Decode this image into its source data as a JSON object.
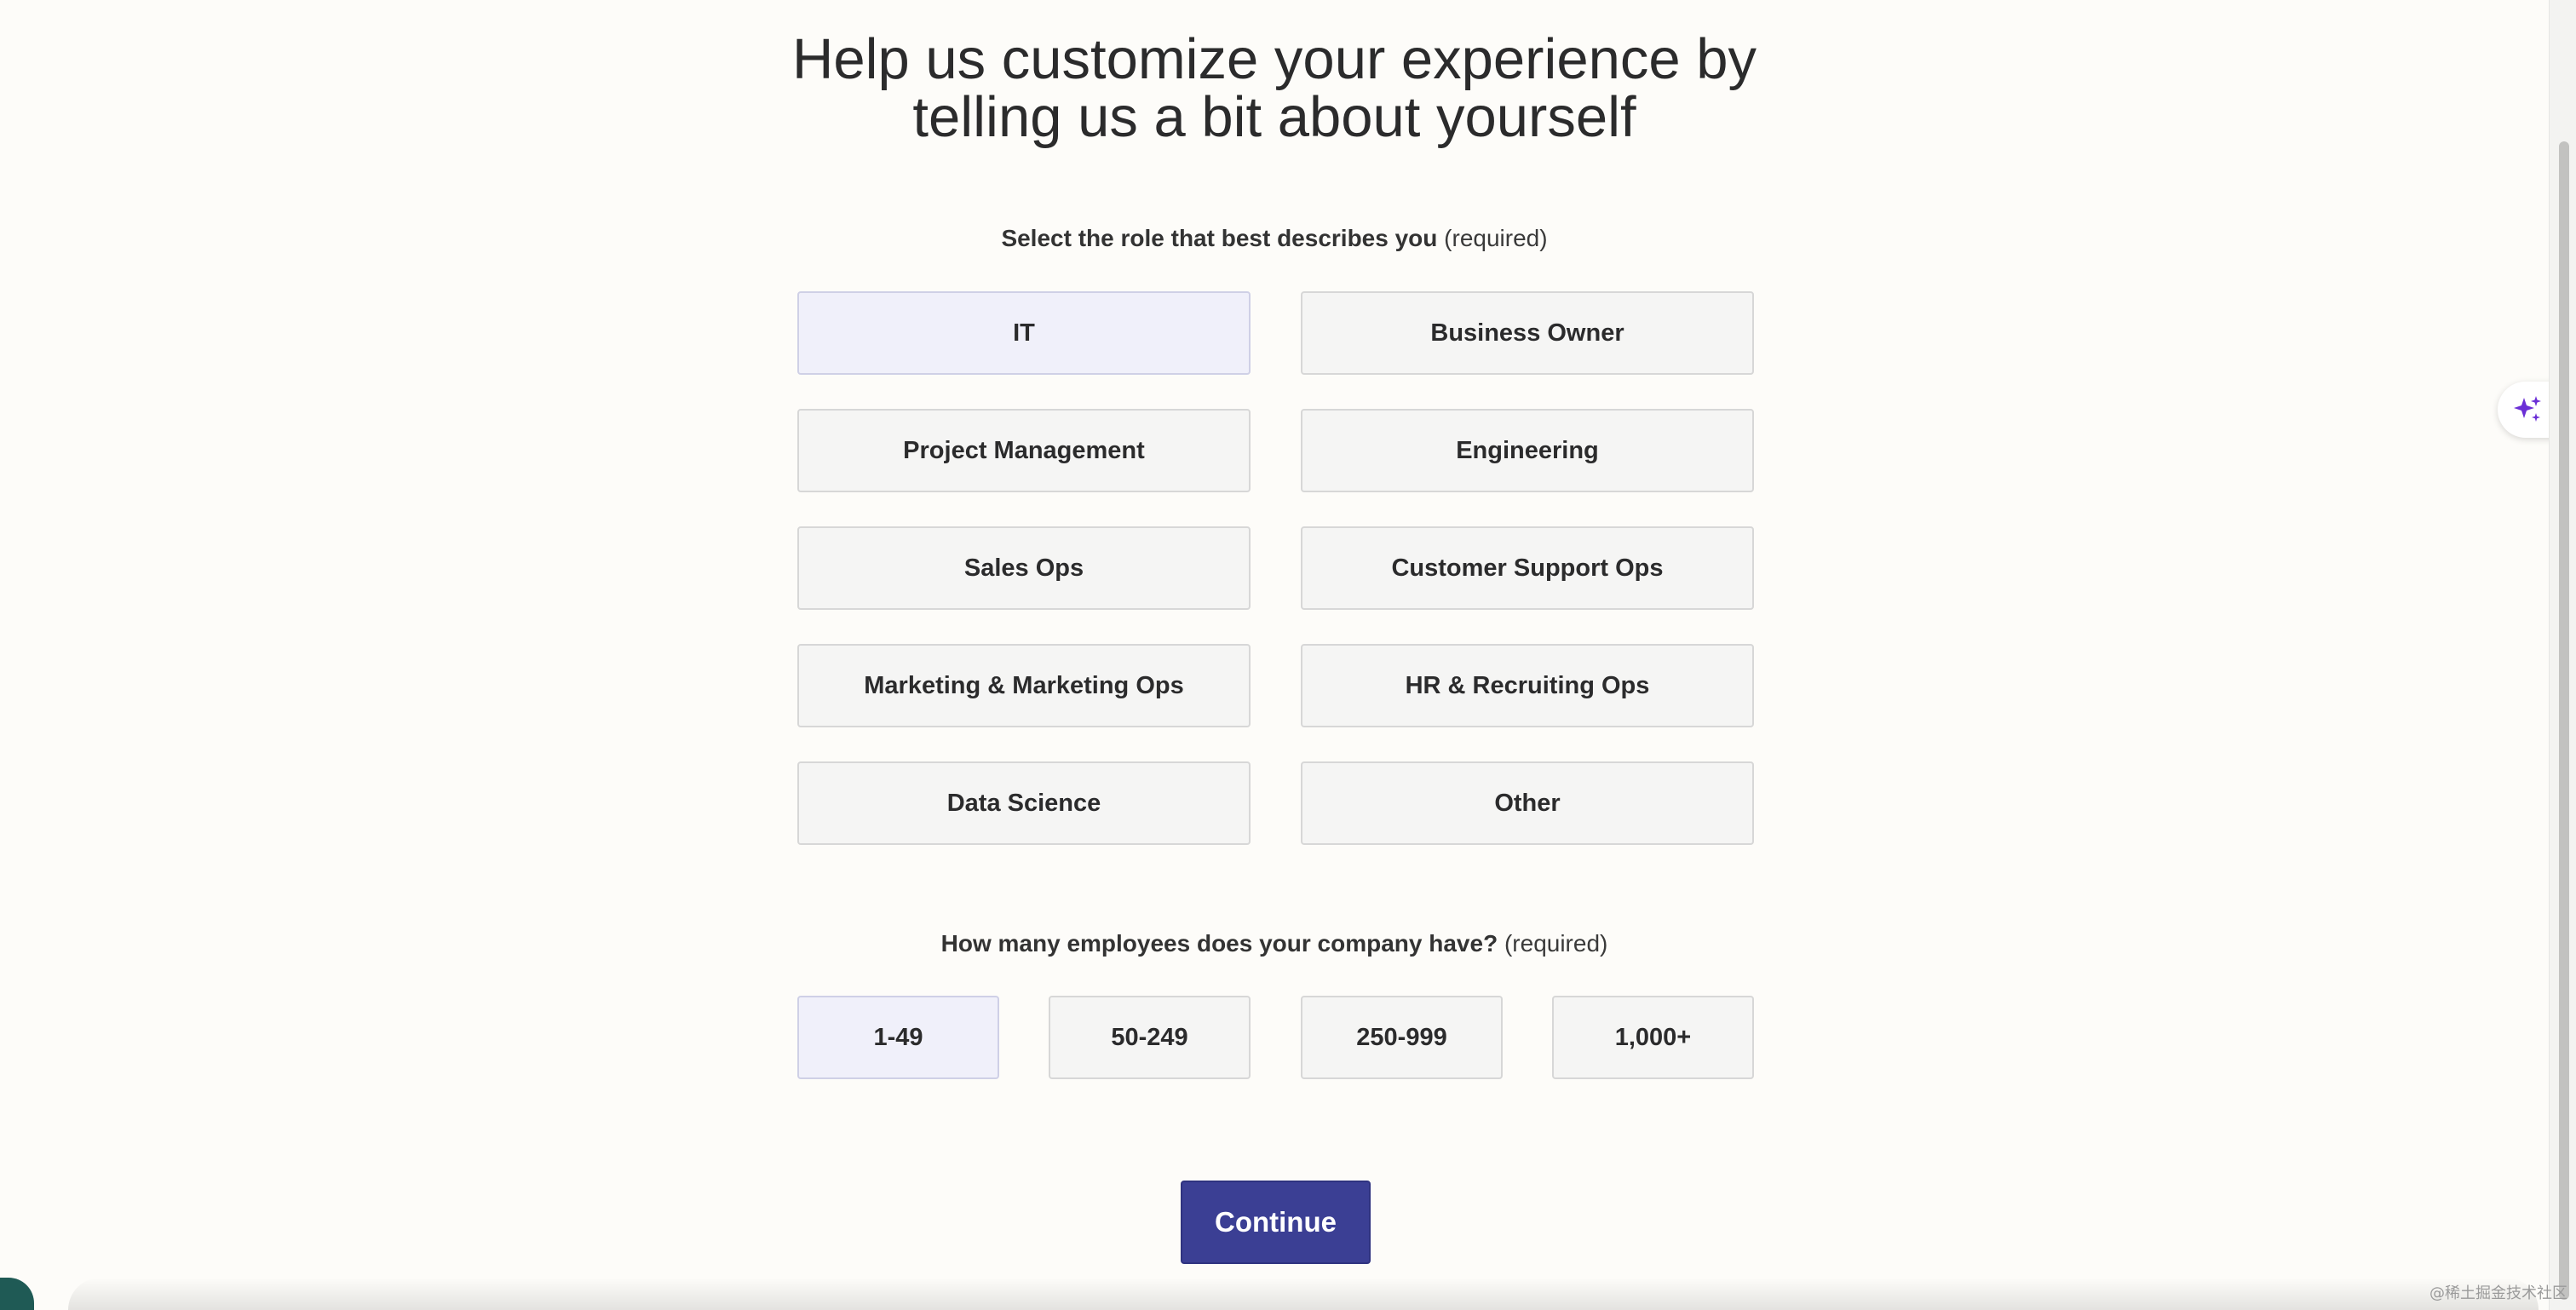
{
  "headline": {
    "line1": "Help us customize your experience by",
    "line2": "telling us a bit about yourself"
  },
  "role_question": {
    "label": "Select the role that best describes you",
    "required": "(required)"
  },
  "roles": [
    {
      "label": "IT",
      "selected": true
    },
    {
      "label": "Business Owner",
      "selected": false
    },
    {
      "label": "Project Management",
      "selected": false
    },
    {
      "label": "Engineering",
      "selected": false
    },
    {
      "label": "Sales Ops",
      "selected": false
    },
    {
      "label": "Customer Support Ops",
      "selected": false
    },
    {
      "label": "Marketing & Marketing Ops",
      "selected": false
    },
    {
      "label": "HR & Recruiting Ops",
      "selected": false
    },
    {
      "label": "Data Science",
      "selected": false
    },
    {
      "label": "Other",
      "selected": false
    }
  ],
  "employee_question": {
    "label": "How many employees does your company have?",
    "required": "(required)"
  },
  "employee_sizes": [
    {
      "label": "1-49",
      "selected": true
    },
    {
      "label": "50-249",
      "selected": false
    },
    {
      "label": "250-999",
      "selected": false
    },
    {
      "label": "1,000+",
      "selected": false
    }
  ],
  "continue_label": "Continue",
  "ai_tab_icon": "sparkles-icon",
  "watermark": "@稀土掘金技术社区",
  "colors": {
    "primary": "#3b3f94",
    "selected_bg": "#f0f0fa",
    "option_bg": "#f5f5f4",
    "sparkle": "#6b2fd6"
  }
}
